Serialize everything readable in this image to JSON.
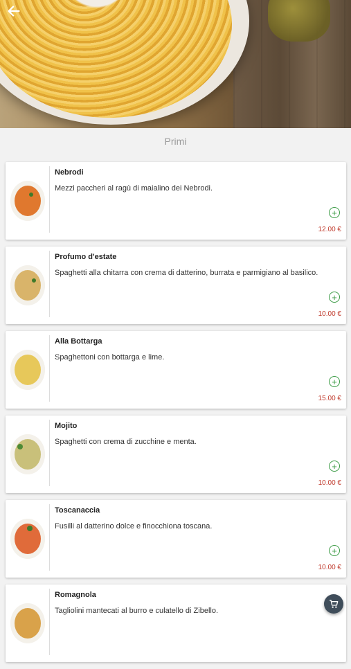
{
  "header": {
    "back_icon": "arrow-left-icon"
  },
  "section": {
    "title": "Primi"
  },
  "items": [
    {
      "name": "Nebrodi",
      "description": "Mezzi paccheri al ragù di maialino dei Nebrodi.",
      "price": "12.00 €",
      "plate": "#e0782e"
    },
    {
      "name": "Profumo d'estate",
      "description": "Spaghetti alla chitarra con crema di datterino, burrata e parmigiano al basilico.",
      "price": "10.00 €",
      "plate": "#d9b46a"
    },
    {
      "name": "Alla Bottarga",
      "description": "Spaghettoni con bottarga e lime.",
      "price": "15.00 €",
      "plate": "#e7c85a"
    },
    {
      "name": "Mojito",
      "description": "Spaghetti con crema di zucchine e menta.",
      "price": "10.00 €",
      "plate": "#c9c07a"
    },
    {
      "name": "Toscanaccia",
      "description": "Fusilli al datterino dolce e finocchiona toscana.",
      "price": "10.00 €",
      "plate": "#e06b3a"
    },
    {
      "name": "Romagnola",
      "description": "Tagliolini mantecati al burro e culatello di Zibello.",
      "price": "",
      "plate": "#d9a24a"
    }
  ],
  "colors": {
    "add": "#3b9b45",
    "price": "#c0392b",
    "cart_bg": "#3f4d5a"
  },
  "cart": {
    "icon": "cart-icon"
  }
}
